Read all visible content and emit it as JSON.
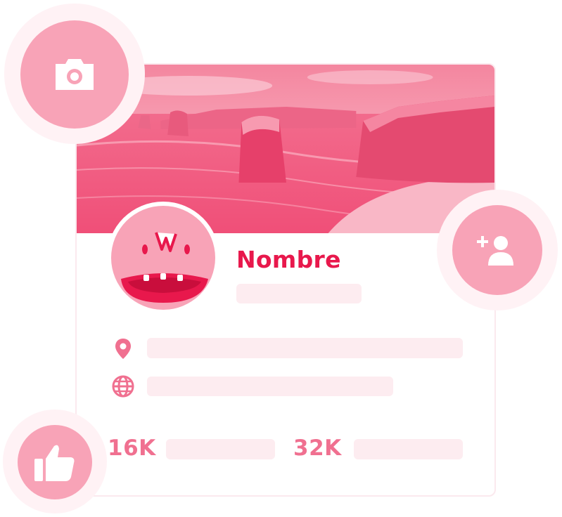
{
  "profile": {
    "name": "Nombre"
  },
  "stats": {
    "first_value": "16K",
    "second_value": "32K"
  },
  "icons": {
    "camera": "camera-icon",
    "add_user": "add-user-icon",
    "like": "thumbs-up-icon",
    "location": "location-pin-icon",
    "website": "globe-icon"
  },
  "colors": {
    "accent": "#e8184c",
    "soft_pink": "#f8a3b7",
    "placeholder": "#fdecf0",
    "stat_text": "#f07090"
  }
}
